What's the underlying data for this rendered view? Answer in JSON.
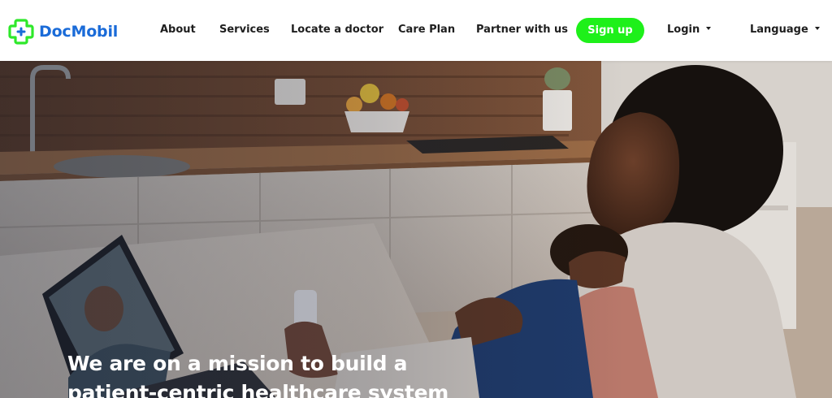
{
  "brand": {
    "name": "DocMobil",
    "color": "#1a6bd8",
    "icon_color": "#2ee82a",
    "logo_icon": "medical-cross-icon"
  },
  "nav": {
    "about": "About",
    "services": "Services",
    "locate": "Locate a doctor",
    "care_plan": "Care Plan",
    "partner": "Partner with us",
    "signup": "Sign up",
    "login": "Login",
    "language": "Language"
  },
  "colors": {
    "accent": "#1ef01a",
    "nav_text": "#1e1e1e",
    "hero_text": "#ffffff"
  },
  "hero": {
    "line1": "We are on a mission to build a",
    "line2": "patient-centric healthcare system"
  }
}
